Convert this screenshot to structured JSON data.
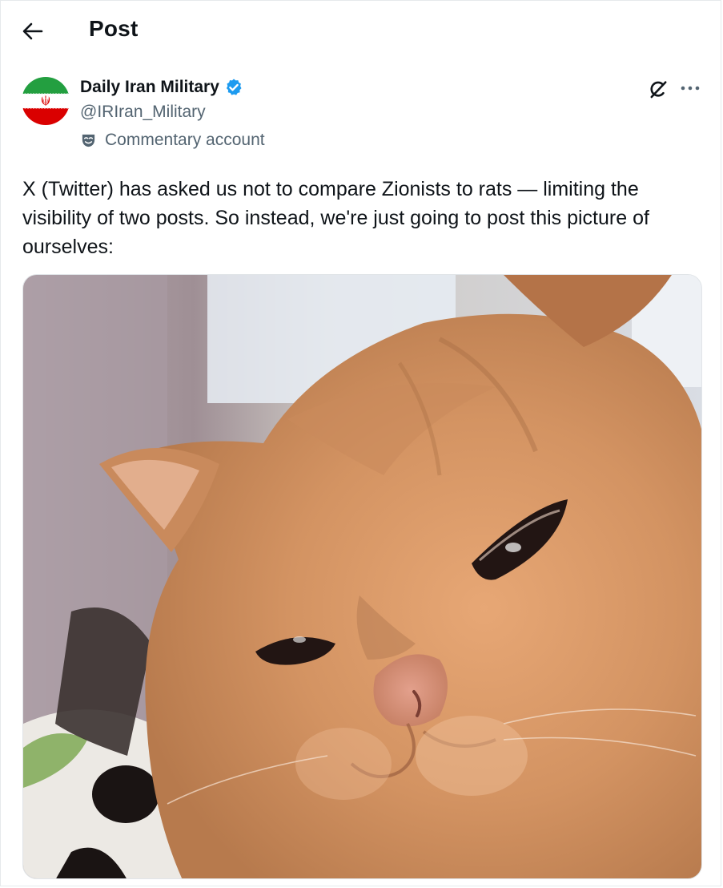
{
  "header": {
    "back_icon": "arrow-left-icon",
    "title": "Post"
  },
  "author": {
    "name": "Daily Iran Military",
    "handle": "@IRIran_Military",
    "verified_icon": "verified-badge-icon",
    "verified_color": "#1d9bf0",
    "label_icon": "theater-mask-icon",
    "label": "Commentary account",
    "avatar_description": "iran-flag-avatar"
  },
  "actions": {
    "grok_icon": "grok-icon",
    "more_icon": "more-horizontal-icon"
  },
  "post": {
    "text": "X (Twitter) has asked us not to compare Zionists to rats — limiting the visibility of two posts. So instead, we're just going to post this picture of ourselves:",
    "media_subject": "orange-cat-photo"
  },
  "colors": {
    "text_primary": "#0f1419",
    "text_secondary": "#536471",
    "accent": "#1d9bf0",
    "flag_green": "#239f40",
    "flag_red": "#da0000"
  }
}
